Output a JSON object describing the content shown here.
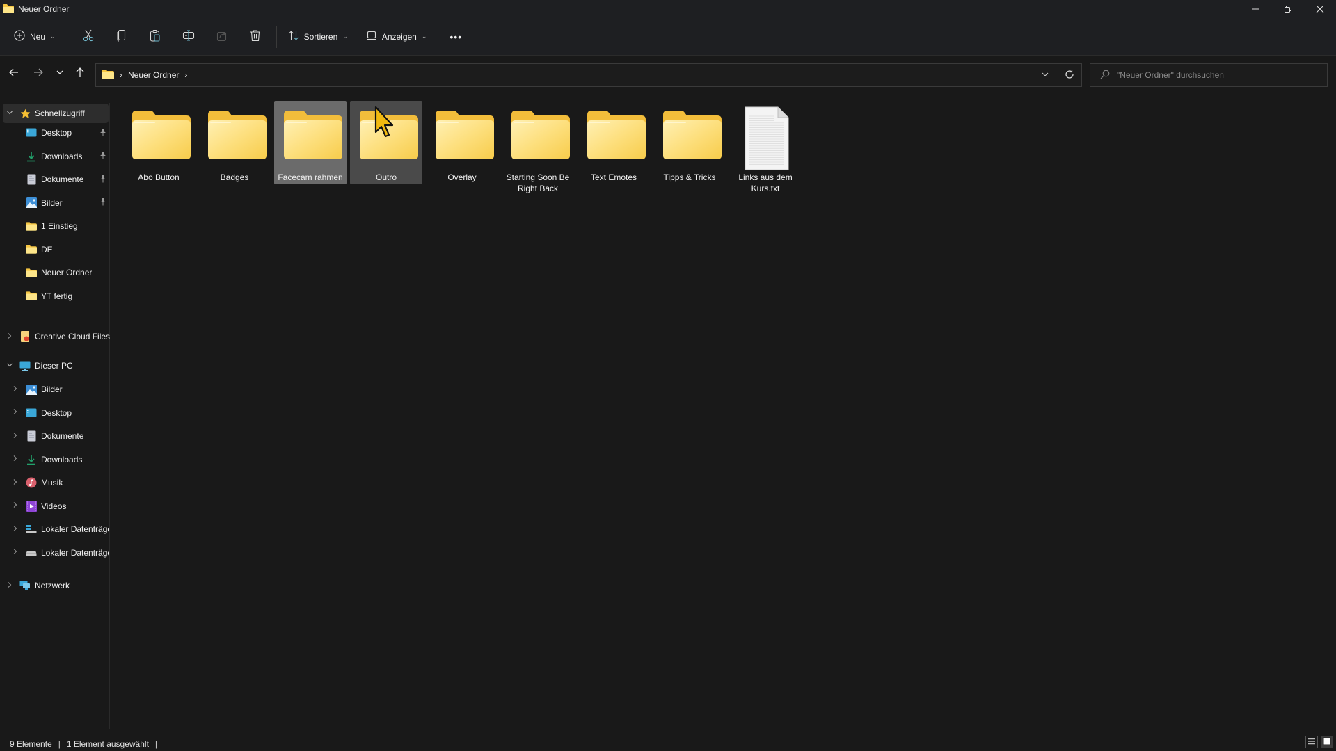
{
  "window": {
    "title": "Neuer Ordner",
    "controls": {
      "minimize": "minimize-icon",
      "restore": "restore-icon",
      "close": "close-icon"
    }
  },
  "toolbar": {
    "new_label": "Neu",
    "actions": [
      {
        "name": "cut",
        "icon": "scissors-icon"
      },
      {
        "name": "copy",
        "icon": "copy-icon"
      },
      {
        "name": "paste",
        "icon": "paste-icon"
      },
      {
        "name": "rename",
        "icon": "rename-icon"
      },
      {
        "name": "share",
        "icon": "share-icon",
        "disabled": true
      },
      {
        "name": "delete",
        "icon": "trash-icon"
      }
    ],
    "sort_label": "Sortieren",
    "view_label": "Anzeigen",
    "more_label": "•••"
  },
  "addressbar": {
    "breadcrumb": [
      "Neuer Ordner"
    ],
    "separator": "›"
  },
  "search": {
    "placeholder": "\"Neuer Ordner\" durchsuchen",
    "value": ""
  },
  "sidebar": {
    "quick_access": {
      "label": "Schnellzugriff",
      "items": [
        {
          "label": "Desktop",
          "icon": "desktop-icon",
          "pinned": true
        },
        {
          "label": "Downloads",
          "icon": "download-icon",
          "pinned": true
        },
        {
          "label": "Dokumente",
          "icon": "documents-icon",
          "pinned": true
        },
        {
          "label": "Bilder",
          "icon": "pictures-icon",
          "pinned": true
        },
        {
          "label": "1 Einstieg",
          "icon": "folder-icon",
          "pinned": false
        },
        {
          "label": "DE",
          "icon": "folder-icon",
          "pinned": false
        },
        {
          "label": "Neuer Ordner",
          "icon": "folder-icon",
          "pinned": false
        },
        {
          "label": "YT fertig",
          "icon": "folder-icon",
          "pinned": false
        }
      ]
    },
    "creative_cloud": {
      "label": "Creative Cloud Files"
    },
    "this_pc": {
      "label": "Dieser PC",
      "items": [
        {
          "label": "Bilder",
          "icon": "pictures-icon"
        },
        {
          "label": "Desktop",
          "icon": "desktop-icon"
        },
        {
          "label": "Dokumente",
          "icon": "documents-icon"
        },
        {
          "label": "Downloads",
          "icon": "download-icon"
        },
        {
          "label": "Musik",
          "icon": "music-icon"
        },
        {
          "label": "Videos",
          "icon": "video-icon"
        },
        {
          "label": "Lokaler Datenträger",
          "icon": "drive-windows-icon"
        },
        {
          "label": "Lokaler Datenträger",
          "icon": "drive-icon"
        }
      ]
    },
    "network": {
      "label": "Netzwerk"
    }
  },
  "files": [
    {
      "name": "Abo Button",
      "type": "folder",
      "state": "normal"
    },
    {
      "name": "Badges",
      "type": "folder",
      "state": "normal"
    },
    {
      "name": "Facecam rahmen",
      "type": "folder",
      "state": "selected"
    },
    {
      "name": "Outro",
      "type": "folder",
      "state": "hover"
    },
    {
      "name": "Overlay",
      "type": "folder",
      "state": "normal"
    },
    {
      "name": "Starting Soon Be Right Back",
      "type": "folder",
      "state": "normal"
    },
    {
      "name": "Text Emotes",
      "type": "folder",
      "state": "normal"
    },
    {
      "name": "Tipps & Tricks",
      "type": "folder",
      "state": "normal"
    },
    {
      "name": "Links aus dem Kurs.txt",
      "type": "text-file",
      "state": "normal"
    }
  ],
  "status": {
    "item_count": "9 Elemente",
    "selection": "1 Element ausgewählt"
  },
  "colors": {
    "folder_light": "#fde589",
    "folder_dark": "#f5c542",
    "selection_bg": "#6b6b6b",
    "hover_bg": "#4a4a4a"
  }
}
